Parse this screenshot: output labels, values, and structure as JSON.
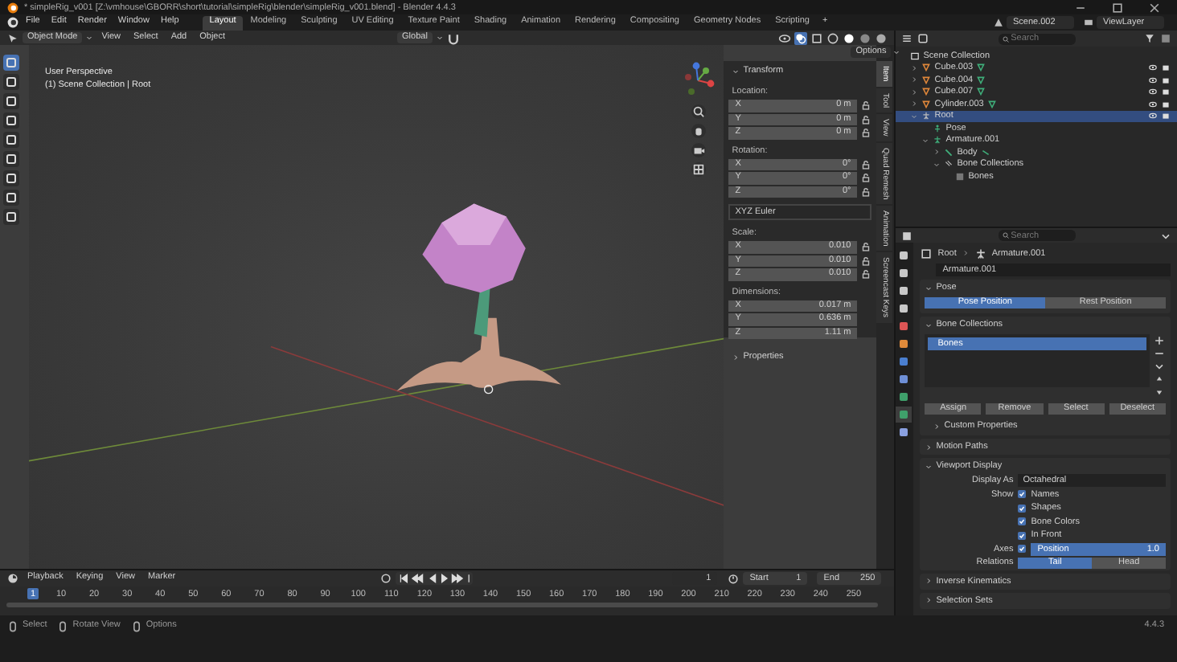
{
  "window": {
    "title": "* simpleRig_v001 [Z:\\vmhouse\\GBORR\\short\\tutorial\\simpleRig\\blender\\simpleRig_v001.blend] - Blender 4.4.3"
  },
  "menus": [
    "File",
    "Edit",
    "Render",
    "Window",
    "Help"
  ],
  "workspaces": [
    {
      "label": "Layout",
      "selected": true
    },
    {
      "label": "Modeling",
      "selected": false
    },
    {
      "label": "Sculpting",
      "selected": false
    },
    {
      "label": "UV Editing",
      "selected": false
    },
    {
      "label": "Texture Paint",
      "selected": false
    },
    {
      "label": "Shading",
      "selected": false
    },
    {
      "label": "Animation",
      "selected": false
    },
    {
      "label": "Rendering",
      "selected": false
    },
    {
      "label": "Compositing",
      "selected": false
    },
    {
      "label": "Geometry Nodes",
      "selected": false
    },
    {
      "label": "Scripting",
      "selected": false
    }
  ],
  "add_workspace": "+",
  "scene": "Scene.002",
  "view_layer": "ViewLayer",
  "viewport": {
    "mode": "Object Mode",
    "menus": [
      "View",
      "Select",
      "Add",
      "Object"
    ],
    "orientation": "Global",
    "options": "Options",
    "view_name": "User Perspective",
    "collection_info": "(1) Scene Collection | Root"
  },
  "sidebar": {
    "panel_title": "Transform",
    "properties_title": "Properties",
    "groups": [
      {
        "label": "Location:",
        "kind": "lockable",
        "rows": [
          {
            "axis": "X",
            "value": "0 m"
          },
          {
            "axis": "Y",
            "value": "0 m"
          },
          {
            "axis": "Z",
            "value": "0 m"
          }
        ]
      },
      {
        "label": "Rotation:",
        "kind": "lockable",
        "mode": "XYZ Euler",
        "rows": [
          {
            "axis": "X",
            "value": "0°"
          },
          {
            "axis": "Y",
            "value": "0°"
          },
          {
            "axis": "Z",
            "value": "0°"
          }
        ]
      },
      {
        "label": "Scale:",
        "kind": "lockable",
        "rows": [
          {
            "axis": "X",
            "value": "0.010"
          },
          {
            "axis": "Y",
            "value": "0.010"
          },
          {
            "axis": "Z",
            "value": "0.010"
          }
        ]
      },
      {
        "label": "Dimensions:",
        "kind": "plain",
        "rows": [
          {
            "axis": "X",
            "value": "0.017 m"
          },
          {
            "axis": "Y",
            "value": "0.636 m"
          },
          {
            "axis": "Z",
            "value": "1.11 m"
          }
        ]
      }
    ],
    "tabs": [
      {
        "label": "Item",
        "selected": true
      },
      {
        "label": "Tool",
        "selected": false
      },
      {
        "label": "View",
        "selected": false
      },
      {
        "label": "Quad Remesh",
        "selected": false
      },
      {
        "label": "Animation",
        "selected": false
      },
      {
        "label": "Screencast Keys",
        "selected": false
      }
    ]
  },
  "outliner": {
    "search_placeholder": "Search",
    "items": [
      {
        "label": "Scene Collection",
        "kind": "scene_collection",
        "selected": false,
        "children": [
          {
            "label": "Cube.003",
            "kind": "mesh_object",
            "selected": false,
            "expanded": false
          },
          {
            "label": "Cube.004",
            "kind": "mesh_object",
            "selected": false,
            "expanded": false
          },
          {
            "label": "Cube.007",
            "kind": "mesh_object",
            "selected": false,
            "expanded": false
          },
          {
            "label": "Cylinder.003",
            "kind": "mesh_object",
            "selected": false,
            "expanded": false
          },
          {
            "label": "Root",
            "kind": "armature_object",
            "selected": true,
            "expanded": true,
            "children": [
              {
                "label": "Pose",
                "kind": "pose",
                "selected": false
              },
              {
                "label": "Armature.001",
                "kind": "armature_data",
                "selected": false,
                "expanded": true,
                "children": [
                  {
                    "label": "Body",
                    "kind": "bone",
                    "selected": false,
                    "expanded": false
                  },
                  {
                    "label": "Bone Collections",
                    "kind": "bone_collections",
                    "selected": false,
                    "expanded": true,
                    "children": [
                      {
                        "label": "Bones",
                        "kind": "bone_collection",
                        "selected": false
                      }
                    ]
                  }
                ]
              }
            ]
          }
        ]
      }
    ]
  },
  "properties": {
    "search_placeholder": "Search",
    "breadcrumb": [
      "Root",
      "Armature.001"
    ],
    "data_name": "Armature.001",
    "panels": [
      {
        "kind": "pose",
        "title": "Pose",
        "expanded": true,
        "options": [
          {
            "label": "Pose Position",
            "selected": true
          },
          {
            "label": "Rest Position",
            "selected": false
          }
        ]
      },
      {
        "kind": "bone_collections",
        "title": "Bone Collections",
        "expanded": true,
        "list": [
          {
            "label": "Bones",
            "selected": true
          }
        ],
        "buttons": [
          "Assign",
          "Remove",
          "Select",
          "Deselect"
        ],
        "subpanel": {
          "title": "Custom Properties",
          "expanded": false
        }
      },
      {
        "title": "Motion Paths",
        "expanded": false
      },
      {
        "kind": "viewport_display",
        "title": "Viewport Display",
        "expanded": true,
        "display_as_label": "Display As",
        "display_as": "Octahedral",
        "show_label": "Show",
        "show": [
          {
            "label": "Names",
            "checked": true
          },
          {
            "label": "Shapes",
            "checked": true
          },
          {
            "label": "Bone Colors",
            "checked": true
          },
          {
            "label": "In Front",
            "checked": true
          }
        ],
        "axes_label": "Axes",
        "axes_checked": true,
        "axes_field": "Position",
        "axes_value": "1.0",
        "relations_label": "Relations",
        "relations": [
          {
            "label": "Tail",
            "selected": true
          },
          {
            "label": "Head",
            "selected": false
          }
        ]
      },
      {
        "title": "Inverse Kinematics",
        "expanded": false
      },
      {
        "title": "Selection Sets",
        "expanded": false
      }
    ]
  },
  "timeline": {
    "menus": [
      "Playback",
      "Keying",
      "View",
      "Marker"
    ],
    "current_frame": "1",
    "start_label": "Start",
    "start": "1",
    "end_label": "End",
    "end": "250",
    "playhead": "1",
    "ticks": [
      "10",
      "20",
      "30",
      "40",
      "50",
      "60",
      "70",
      "80",
      "90",
      "100",
      "110",
      "120",
      "130",
      "140",
      "150",
      "160",
      "170",
      "180",
      "190",
      "200",
      "210",
      "220",
      "230",
      "240",
      "250"
    ]
  },
  "status_bar": {
    "items": [
      "Select",
      "Rotate View",
      "Options"
    ],
    "version": "4.4.3"
  }
}
